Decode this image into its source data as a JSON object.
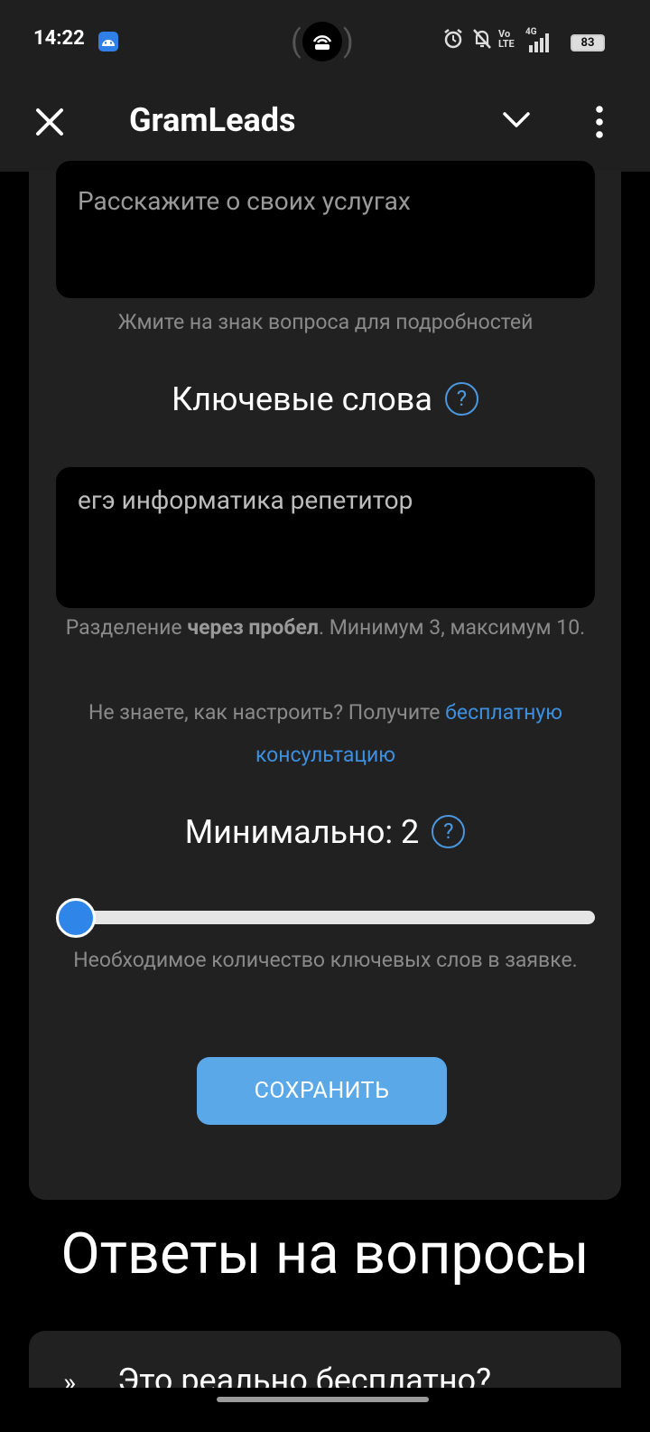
{
  "status_bar": {
    "time": "14:22",
    "battery": "83",
    "icons": [
      "android-icon",
      "hotspot-icon",
      "alarm-icon",
      "mute-icon",
      "volte-icon",
      "signal-4g-icon",
      "battery-icon"
    ],
    "volte_label_top": "Vo",
    "volte_label_bottom": "LTE",
    "network_label": "4G"
  },
  "app_bar": {
    "title": "GramLeads",
    "icons": [
      "close-icon",
      "chevron-down-icon",
      "more-vert-icon"
    ]
  },
  "form": {
    "services_placeholder": "Расскажите о своих услугах",
    "services_hint": "Жмите на знак вопроса для подробностей",
    "keywords_title": "Ключевые слова",
    "keywords_value": "егэ информатика репетитор",
    "keywords_hint_pre": "Разделение ",
    "keywords_hint_bold": "через пробел",
    "keywords_hint_post": ". Минимум 3, максимум 10.",
    "consult_pre": "Не знаете, как настроить? Получите ",
    "consult_link": "бесплатную консультацию",
    "minimum_title": "Минимально: 2",
    "minimum_value": 2,
    "slider_fraction": 0.0,
    "minimum_hint": "Необходимое количество ключевых слов в заявке.",
    "help_symbol": "?",
    "save_label": "СОХРАНИТЬ"
  },
  "faq": {
    "title": "Ответы на вопросы",
    "items": [
      {
        "chevron": "»",
        "label": "Это реально бесплатно?"
      }
    ]
  },
  "colors": {
    "accent": "#2f86e8",
    "link": "#3d8fe0",
    "button": "#5aa8e8",
    "card": "#212121"
  }
}
